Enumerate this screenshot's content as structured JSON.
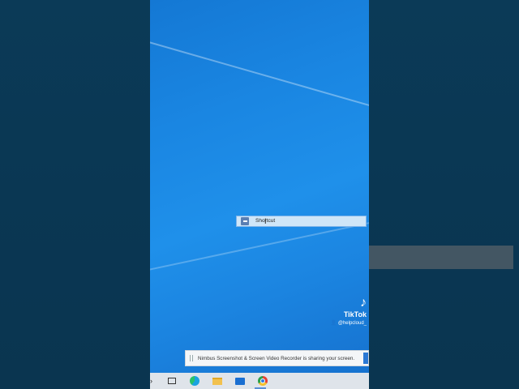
{
  "rename": {
    "value": "Shortcut"
  },
  "watermark": {
    "logo_glyph": "♪",
    "name": "TikTok",
    "username": "👤 @helpcloud_"
  },
  "share_bar": {
    "message": "Nimbus Screenshot & Screen Video Recorder is sharing your screen."
  },
  "taskbar": {
    "items": [
      {
        "icon": "chevron-right-icon",
        "glyph": "›"
      },
      {
        "icon": "task-view-icon"
      },
      {
        "icon": "edge-icon"
      },
      {
        "icon": "file-explorer-icon"
      },
      {
        "icon": "mail-icon"
      },
      {
        "icon": "chrome-icon"
      }
    ]
  },
  "colors": {
    "desktop": "#1a86e2",
    "side_background": "#0a3550",
    "rename_background": "#cfe6f8",
    "taskbar": "#dfe4ea"
  }
}
